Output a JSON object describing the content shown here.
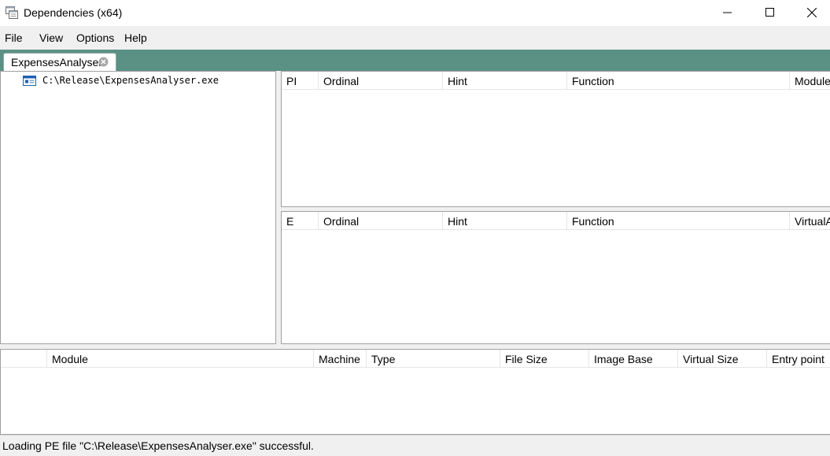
{
  "window": {
    "title": "Dependencies (x64)"
  },
  "menu": {
    "items": [
      "File",
      "View",
      "Options",
      "Help"
    ]
  },
  "tabs": [
    {
      "label": "ExpensesAnalyser"
    }
  ],
  "tree": {
    "root_label": "C:\\Release\\ExpensesAnalyser.exe"
  },
  "imports_table": {
    "columns": [
      "PI",
      "Ordinal",
      "Hint",
      "Function",
      "Module"
    ],
    "rows": []
  },
  "exports_table": {
    "columns": [
      "E",
      "Ordinal",
      "Hint",
      "Function",
      "VirtualA"
    ],
    "rows": []
  },
  "modules_table": {
    "columns": [
      "",
      "Module",
      "Machine",
      "Type",
      "File Size",
      "Image Base",
      "Virtual Size",
      "Entry point"
    ],
    "rows": []
  },
  "status": {
    "text": "Loading PE file \"C:\\Release\\ExpensesAnalyser.exe\" successful."
  },
  "colors": {
    "tabstrip": "#5b9085",
    "chrome": "#f0f0f0",
    "border": "#a0a0a0"
  }
}
